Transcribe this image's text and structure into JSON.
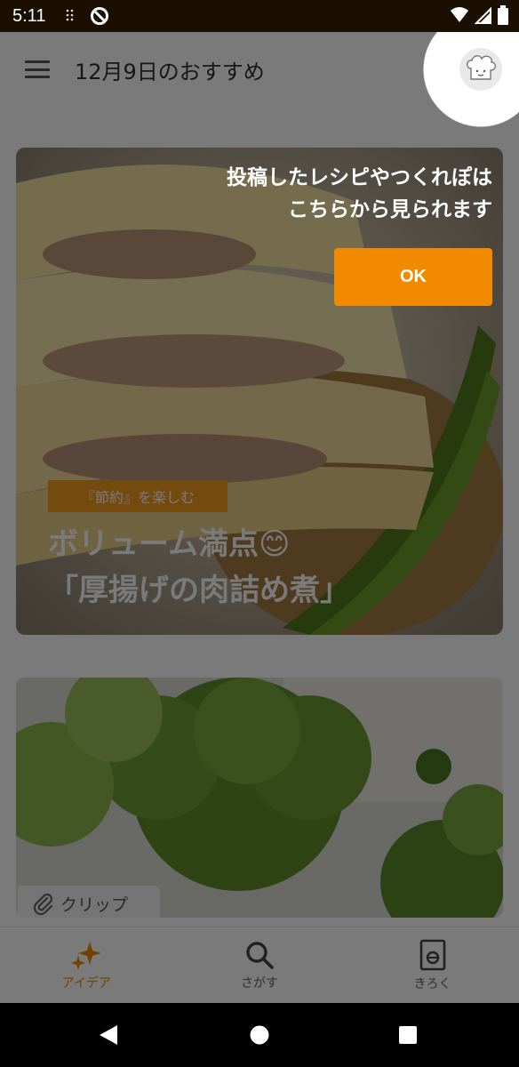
{
  "status_bar": {
    "time": "5:11"
  },
  "app_bar": {
    "title": "12月9日のおすすめ"
  },
  "cards": [
    {
      "tag": "『節約』を楽しむ",
      "title": "ボリューム満点😊\n「厚揚げの肉詰め煮」"
    },
    {
      "clip_label": "クリップ"
    }
  ],
  "bottom_nav": [
    {
      "label": "アイデア",
      "icon": "sparkle-icon",
      "active": true
    },
    {
      "label": "さがす",
      "icon": "search-icon",
      "active": false
    },
    {
      "label": "きろく",
      "icon": "kiroku-icon",
      "active": false
    }
  ],
  "tutorial": {
    "message_line1": "投稿したレシピやつくれぽは",
    "message_line2": "こちらから見られます",
    "ok_label": "OK"
  },
  "colors": {
    "accent": "#f28a00",
    "status_bar_bg": "#1a0f00"
  }
}
